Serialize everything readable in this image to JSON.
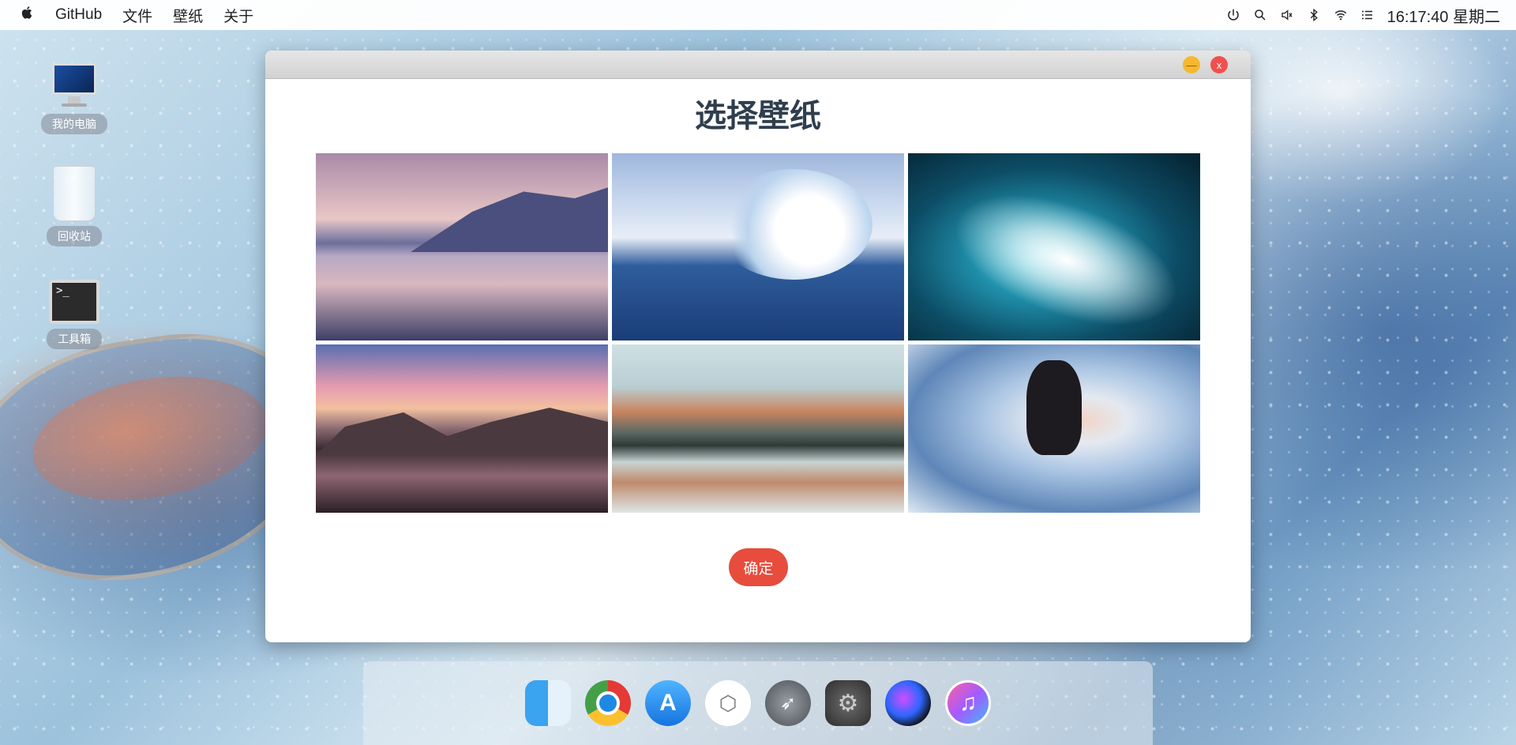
{
  "menubar": {
    "apple": "",
    "items": [
      "GitHub",
      "文件",
      "壁纸",
      "关于"
    ],
    "clock": "16:17:40 星期二",
    "status_icons": [
      "power-icon",
      "search-icon",
      "volume-icon",
      "bluetooth-icon",
      "wifi-icon",
      "list-icon"
    ]
  },
  "desktop": {
    "icons": [
      {
        "label": "我的电脑",
        "icon": "computer-icon"
      },
      {
        "label": "回收站",
        "icon": "trash-icon"
      },
      {
        "label": "工具箱",
        "icon": "terminal-icon"
      }
    ],
    "terminal_prompt": ">_"
  },
  "dialog": {
    "title": "选择壁纸",
    "minimize_label": "—",
    "close_label": "x",
    "confirm_label": "确定",
    "wallpapers": [
      "lake-mountain-dusk",
      "ocean-wave-curl",
      "teal-ocean-wave",
      "lake-rocks-sunset",
      "mountain-lake-reflection",
      "swordswoman-painting"
    ]
  },
  "dock": {
    "items": [
      "finder-icon",
      "chrome-icon",
      "app-store-icon",
      "codepen-icon",
      "launchpad-icon",
      "system-preferences-icon",
      "siri-icon",
      "itunes-icon"
    ],
    "glyphs": {
      "appstore": "A",
      "codepen": "⬡",
      "launchpad": "➶",
      "settings": "⚙",
      "itunes": "♫"
    }
  },
  "colors": {
    "confirm": "#e74c3c",
    "close": "#f24f4f",
    "minimize": "#f5b82e",
    "title": "#2f3e4d"
  }
}
